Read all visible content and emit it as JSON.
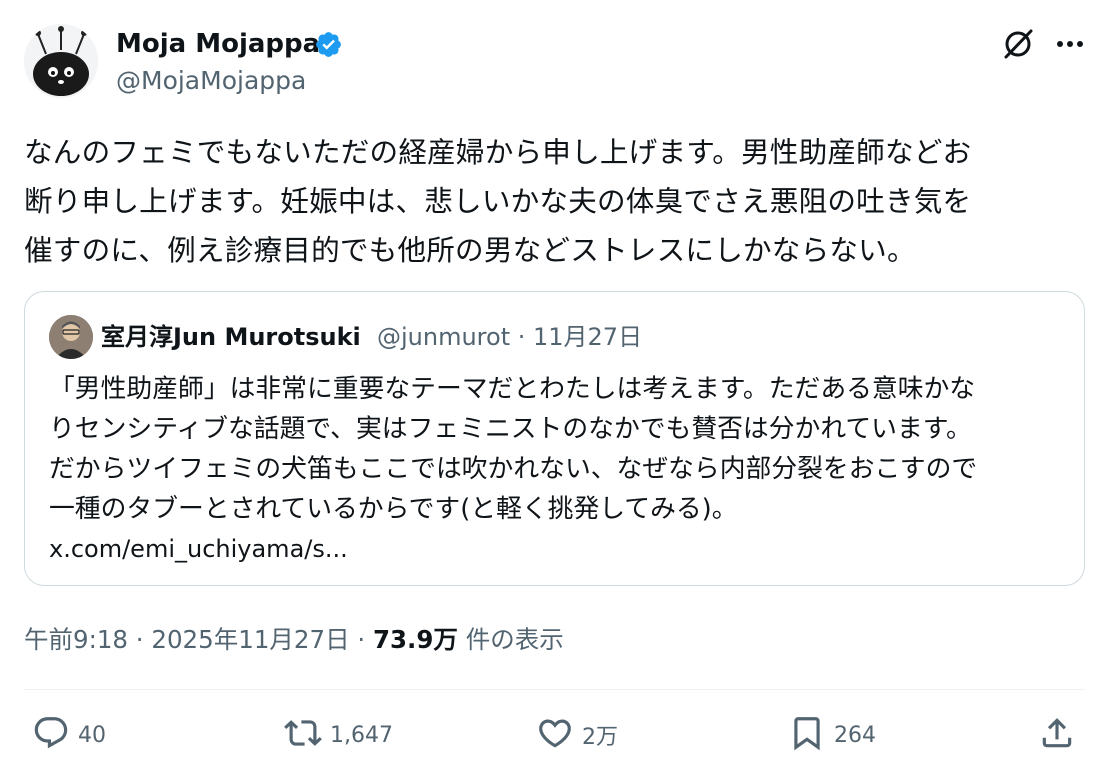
{
  "author": {
    "display_name": "Moja Mojappa",
    "handle": "@MojaMojappa",
    "verified": true,
    "verified_color": "#1d9bf0"
  },
  "icons": {
    "grok": "grok-icon",
    "more": "more-options-icon",
    "reply": "reply-icon",
    "repost": "repost-icon",
    "like": "like-icon",
    "bookmark": "bookmark-icon",
    "share": "share-icon"
  },
  "tweet": {
    "lines": [
      "なんのフェミでもないただの経産婦から申し上げます。男性助産師などお",
      "断り申し上げます。妊娠中は、悲しいかな夫の体臭でさえ悪阻の吐き気を",
      "催すのに、例え診療目的でも他所の男などストレスにしかならない。"
    ]
  },
  "quote": {
    "display_name": "室月淳Jun Murotsuki",
    "meta": "@junmurot · 11月27日",
    "lines": [
      "「男性助産師」は非常に重要なテーマだとわたしは考えます。ただある意味かな",
      "りセンシティブな話題で、実はフェミニストのなかでも賛否は分かれています。",
      "だからツイフェミの犬笛もここでは吹かれない、なぜなら内部分裂をおこすので",
      "一種のタブーとされているからです(と軽く挑発してみる)。"
    ],
    "link": "x.com/emi_uchiyama/s..."
  },
  "meta": {
    "timestamp": "午前9:18 · 2025年11月27日 · ",
    "views_count": "73.9万",
    "views_label": " 件の表示"
  },
  "actions": {
    "replies": "40",
    "reposts": "1,647",
    "likes": "2万",
    "bookmarks": "264"
  },
  "colors": {
    "text": "#0f1419",
    "secondary": "#536471",
    "border": "#cfd9de"
  }
}
